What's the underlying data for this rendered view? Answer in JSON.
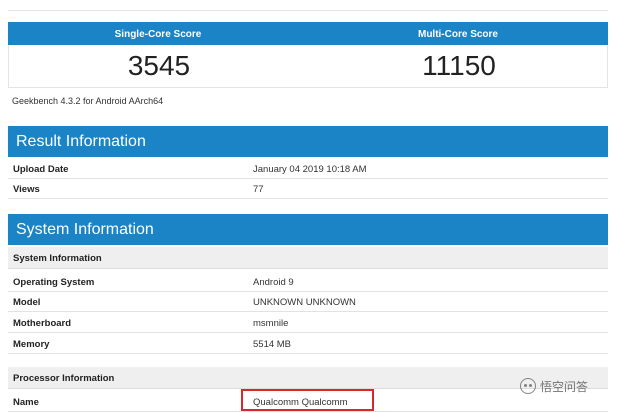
{
  "scores": {
    "single_label": "Single-Core Score",
    "multi_label": "Multi-Core Score",
    "single_value": "3545",
    "multi_value": "11150"
  },
  "benchmark_version": "Geekbench 4.3.2 for Android AArch64",
  "result_info": {
    "title": "Result Information",
    "rows": [
      {
        "key": "Upload Date",
        "value": "January 04 2019 10:18 AM"
      },
      {
        "key": "Views",
        "value": "77"
      }
    ]
  },
  "system_info": {
    "title": "System Information",
    "subheading": "System Information",
    "rows": [
      {
        "key": "Operating System",
        "value": "Android 9"
      },
      {
        "key": "Model",
        "value": "UNKNOWN UNKNOWN"
      },
      {
        "key": "Motherboard",
        "value": "msmnile"
      },
      {
        "key": "Memory",
        "value": "5514 MB"
      }
    ],
    "processor_subheading": "Processor Information",
    "processor_rows": [
      {
        "key": "Name",
        "value": "Qualcomm Qualcomm"
      }
    ]
  },
  "watermark": {
    "text": "悟空问答",
    "icon": "wukong-logo-icon"
  },
  "colors": {
    "header_blue": "#1b84c6",
    "highlight_red": "#d62a2a"
  }
}
